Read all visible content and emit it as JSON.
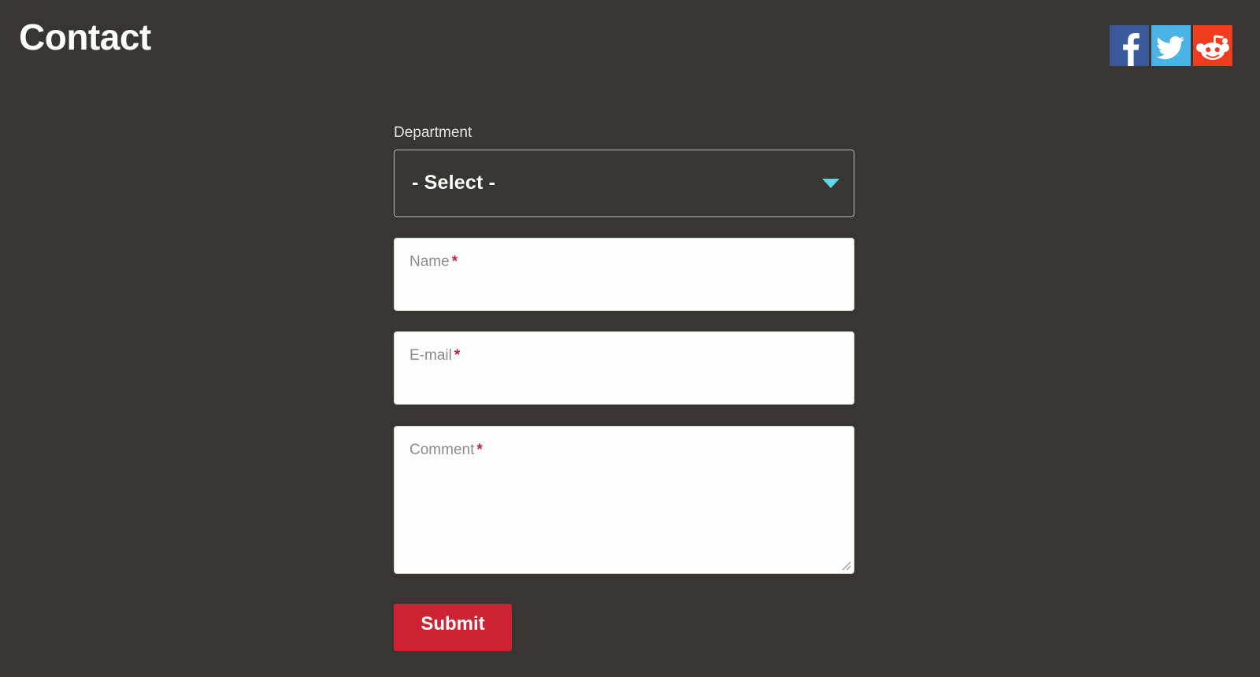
{
  "page": {
    "title": "Contact",
    "background_color": "#383633"
  },
  "social": {
    "items": [
      {
        "name": "facebook",
        "icon": "facebook-icon",
        "label": "Facebook",
        "color": "#3b5998"
      },
      {
        "name": "twitter",
        "icon": "twitter-icon",
        "label": "Twitter",
        "color": "#4cb3e8"
      },
      {
        "name": "reddit",
        "icon": "reddit-icon",
        "label": "Reddit",
        "color": "#f03c1e"
      }
    ]
  },
  "form": {
    "department": {
      "label": "Department",
      "selected_value": "- Select -",
      "arrow_icon": "chevron-down-icon",
      "arrow_color": "#5fd7e8"
    },
    "fields": [
      {
        "name": "name",
        "placeholder": "Name",
        "value": "",
        "required": true,
        "required_marker": "*"
      },
      {
        "name": "email",
        "placeholder": "E-mail",
        "value": "",
        "required": true,
        "required_marker": "*"
      },
      {
        "name": "comment",
        "placeholder": "Comment",
        "value": "",
        "required": true,
        "required_marker": "*"
      }
    ],
    "submit": {
      "label": "Submit",
      "color": "#cc2233"
    }
  },
  "colors": {
    "accent_cyan": "#5fd7e8",
    "required_red": "#c8203c",
    "submit_red": "#cc2233",
    "field_white": "#fdfdfd",
    "text_light": "#e8e6e3"
  }
}
